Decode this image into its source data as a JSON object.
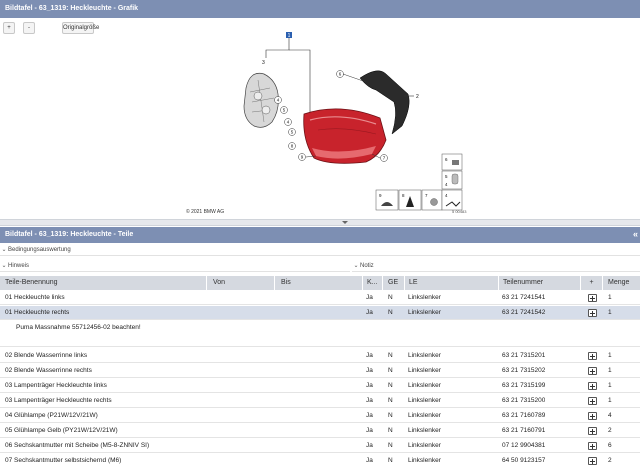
{
  "window": {
    "graphic_title": "Bildtafel - 63_1319: Heckleuchte - Grafik",
    "parts_title": "Bildtafel - 63_1319: Heckleuchte - Teile",
    "collapse_glyph": "«"
  },
  "toolbar": {
    "zoom_in_label": "+",
    "zoom_out_label": "-",
    "original_size_label": "Originalgröße"
  },
  "graphic": {
    "copyright": "© 2021 BMW AG",
    "image_code": "5 00483",
    "callouts": [
      "1",
      "2",
      "3",
      "4",
      "5",
      "6",
      "7",
      "8",
      "9"
    ],
    "inset_labels": [
      "6",
      "5",
      "4",
      "9",
      "8",
      "7",
      "4"
    ]
  },
  "sections": {
    "condition": "Bedingungsauswertung",
    "hint": "Hinweis",
    "note": "Notiz"
  },
  "table": {
    "headers": {
      "name": "Teile-Benennung",
      "from": "Von",
      "to": "Bis",
      "k": "K...",
      "ge": "GE",
      "le": "LE",
      "part_number": "Teilenummer",
      "add": "+",
      "qty": "Menge"
    },
    "rows_top": [
      {
        "name": "01 Heckleuchte links",
        "k": "Ja",
        "ge": "N",
        "le": "Linkslenker",
        "part_number": "63 21 7241541",
        "qty": "1"
      },
      {
        "name": "01 Heckleuchte rechts",
        "k": "Ja",
        "ge": "N",
        "le": "Linkslenker",
        "part_number": "63 21 7241542",
        "qty": "1"
      }
    ],
    "row_note": "Puma Massnahme 55712456-02 beachten!",
    "rows": [
      {
        "name": "02 Blende Wasserrinne links",
        "k": "Ja",
        "ge": "N",
        "le": "Linkslenker",
        "part_number": "63 21 7315201",
        "qty": "1"
      },
      {
        "name": "02 Blende Wasserrinne rechts",
        "k": "Ja",
        "ge": "N",
        "le": "Linkslenker",
        "part_number": "63 21 7315202",
        "qty": "1"
      },
      {
        "name": "03 Lampenträger Heckleuchte links",
        "k": "Ja",
        "ge": "N",
        "le": "Linkslenker",
        "part_number": "63 21 7315199",
        "qty": "1"
      },
      {
        "name": "03 Lampenträger Heckleuchte rechts",
        "k": "Ja",
        "ge": "N",
        "le": "Linkslenker",
        "part_number": "63 21 7315200",
        "qty": "1"
      },
      {
        "name": "04 Glühlampe (P21W/12V/21W)",
        "k": "Ja",
        "ge": "N",
        "le": "Linkslenker",
        "part_number": "63 21 7160789",
        "qty": "4"
      },
      {
        "name": "05 Glühlampe Gelb (PY21W/12V/21W)",
        "k": "Ja",
        "ge": "N",
        "le": "Linkslenker",
        "part_number": "63 21 7160791",
        "qty": "2"
      },
      {
        "name": "06 Sechskantmutter mit Scheibe (M5-8-ZNNIV SI)",
        "k": "Ja",
        "ge": "N",
        "le": "Linkslenker",
        "part_number": "07 12 9904381",
        "qty": "6"
      },
      {
        "name": "07 Sechskantmutter selbstsichernd (M6)",
        "k": "Ja",
        "ge": "N",
        "le": "Linkslenker",
        "part_number": "64 50 9123157",
        "qty": "2"
      }
    ]
  },
  "colors": {
    "titlebar": "#7d8fb3",
    "header": "#d5d9e0",
    "selected_row": "#d6dde9",
    "lamp_red": "#c8232c"
  }
}
